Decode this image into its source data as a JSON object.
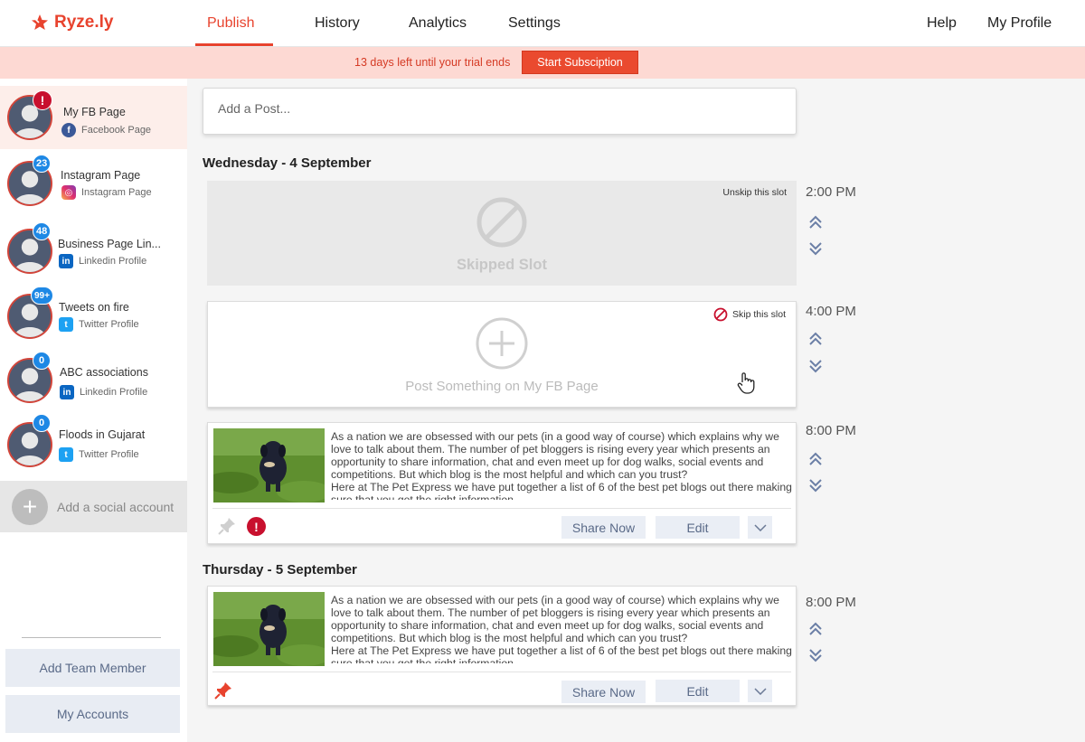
{
  "app": {
    "logo_text": "Ryze.ly"
  },
  "nav": {
    "tabs": [
      {
        "label": "Publish",
        "active": true
      },
      {
        "label": "History"
      },
      {
        "label": "Analytics"
      },
      {
        "label": "Settings"
      }
    ],
    "help": "Help",
    "profile": "My Profile"
  },
  "banner": {
    "text": "13 days left until your trial ends",
    "button": "Start Subsciption"
  },
  "sidebar": {
    "accounts": [
      {
        "name": "My FB Page",
        "type": "Facebook Page",
        "network": "facebook-icon",
        "badge": "!",
        "selected": true
      },
      {
        "name": "Instagram Page",
        "type": "Instagram Page",
        "network": "instagram-icon",
        "badge": "23"
      },
      {
        "name": "Business Page Lin...",
        "type": "Linkedin Profile",
        "network": "linkedin-icon",
        "badge": "48"
      },
      {
        "name": "Tweets on fire",
        "type": "Twitter Profile",
        "network": "twitter-icon",
        "badge": "99+"
      },
      {
        "name": "ABC associations",
        "type": "Linkedin Profile",
        "network": "linkedin-icon",
        "badge": "0"
      },
      {
        "name": "Floods in Gujarat",
        "type": "Twitter Profile",
        "network": "twitter-icon",
        "badge": "0"
      }
    ],
    "add_account": "Add a social account",
    "add_team": "Add Team Member",
    "my_accounts": "My Accounts"
  },
  "composer": {
    "placeholder": "Add a Post..."
  },
  "days": [
    {
      "heading": "Wednesday - 4 September",
      "slots": [
        {
          "time": "2:00 PM",
          "kind": "skipped",
          "corner": "Unskip this slot",
          "label": "Skipped Slot"
        },
        {
          "time": "4:00 PM",
          "kind": "empty",
          "corner": "Skip this slot",
          "label": "Post Something on My FB Page"
        },
        {
          "time": "8:00 PM",
          "kind": "post",
          "pinned": false,
          "error": true
        }
      ]
    },
    {
      "heading": "Thursday - 5 September",
      "slots": [
        {
          "time": "8:00 PM",
          "kind": "post",
          "pinned": true,
          "error": false
        }
      ]
    }
  ],
  "post": {
    "text": "As a nation we are obsessed with our pets (in a good way of course) which explains why we love to talk about them. The number of pet bloggers is rising every year which presents an opportunity to share information, chat and even meet up for dog walks, social events and competitions. But which blog is the most helpful and which can you trust?\nHere at The Pet Express we have put together a list of 6 of the best pet blogs out there making sure that you get the right information.",
    "share": "Share Now",
    "edit": "Edit"
  },
  "colors": {
    "accent": "#e8432e",
    "badge_blue": "#1e88e5",
    "alert_red": "#c8102e",
    "button_text": "#5a6a88"
  }
}
